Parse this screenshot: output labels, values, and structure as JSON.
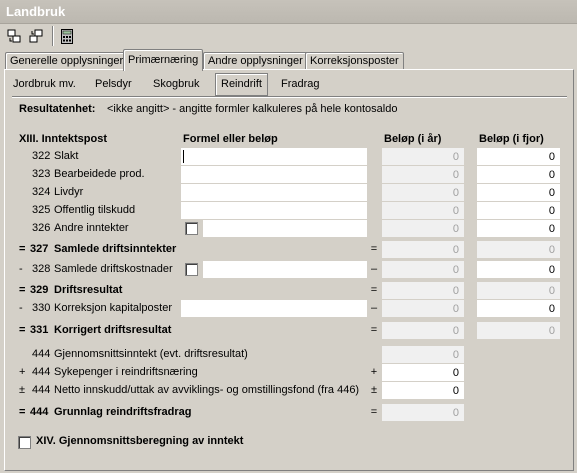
{
  "window": {
    "title": "Landbruk"
  },
  "toolbar": {
    "icons": [
      "copy-forward-icon",
      "copy-back-icon",
      "calculator-icon"
    ]
  },
  "tabs": [
    "Generelle opplysninger",
    "Primærnæring",
    "Andre opplysninger",
    "Korreksjonsposter"
  ],
  "subtabs": [
    "Jordbruk mv.",
    "Pelsdyr",
    "Skogbruk",
    "Reindrift",
    "Fradrag"
  ],
  "result_unit": {
    "label": "Resultatenhet:",
    "text": "<ikke angitt> - angitte formler kalkuleres på hele kontosaldo"
  },
  "headers": {
    "post": "XIII. Inntektspost",
    "formula": "Formel eller beløp",
    "current": "Beløp (i år)",
    "previous": "Beløp (i fjor)"
  },
  "rows": {
    "r322": {
      "code": "322",
      "label": "Slakt",
      "current": "0",
      "previous": "0"
    },
    "r323": {
      "code": "323",
      "label": "Bearbeidede prod.",
      "current": "0",
      "previous": "0"
    },
    "r324": {
      "code": "324",
      "label": "Livdyr",
      "current": "0",
      "previous": "0"
    },
    "r325": {
      "code": "325",
      "label": "Offentlig tilskudd",
      "current": "0",
      "previous": "0"
    },
    "r326": {
      "code": "326",
      "label": "Andre inntekter",
      "current": "0",
      "previous": "0"
    },
    "r327": {
      "prefix": "=",
      "code": "327",
      "label": "Samlede driftsinntekter",
      "op": "=",
      "current": "0",
      "previous": "0"
    },
    "r328": {
      "prefix": "-",
      "code": "328",
      "label": "Samlede driftskostnader",
      "op": "–",
      "current": "0",
      "previous": "0"
    },
    "r329": {
      "prefix": "=",
      "code": "329",
      "label": "Driftsresultat",
      "op": "=",
      "current": "0",
      "previous": "0"
    },
    "r330": {
      "prefix": "-",
      "code": "330",
      "label": "Korreksjon kapitalposter",
      "op": "–",
      "current": "0",
      "previous": "0"
    },
    "r331": {
      "prefix": "=",
      "code": "331",
      "label": "Korrigert driftsresultat",
      "op": "=",
      "current": "0",
      "previous": "0"
    },
    "r444a": {
      "code": "444",
      "label": "Gjennomsnittsinntekt (evt. driftsresultat)",
      "current": "0"
    },
    "r444b": {
      "prefix": "+",
      "code": "444",
      "label": "Sykepenger i reindriftsnæring",
      "op": "+",
      "current": "0"
    },
    "r444c": {
      "prefix": "±",
      "code": "444",
      "label": "Netto innskudd/uttak av avviklings- og omstillingsfond (fra 446)",
      "op": "±",
      "current": "0"
    },
    "r444d": {
      "prefix": "=",
      "code": "444",
      "label": "Grunnlag reindriftsfradrag",
      "op": "=",
      "current": "0"
    }
  },
  "footer": {
    "label": "XIV. Gjennomsnittsberegning av inntekt"
  }
}
